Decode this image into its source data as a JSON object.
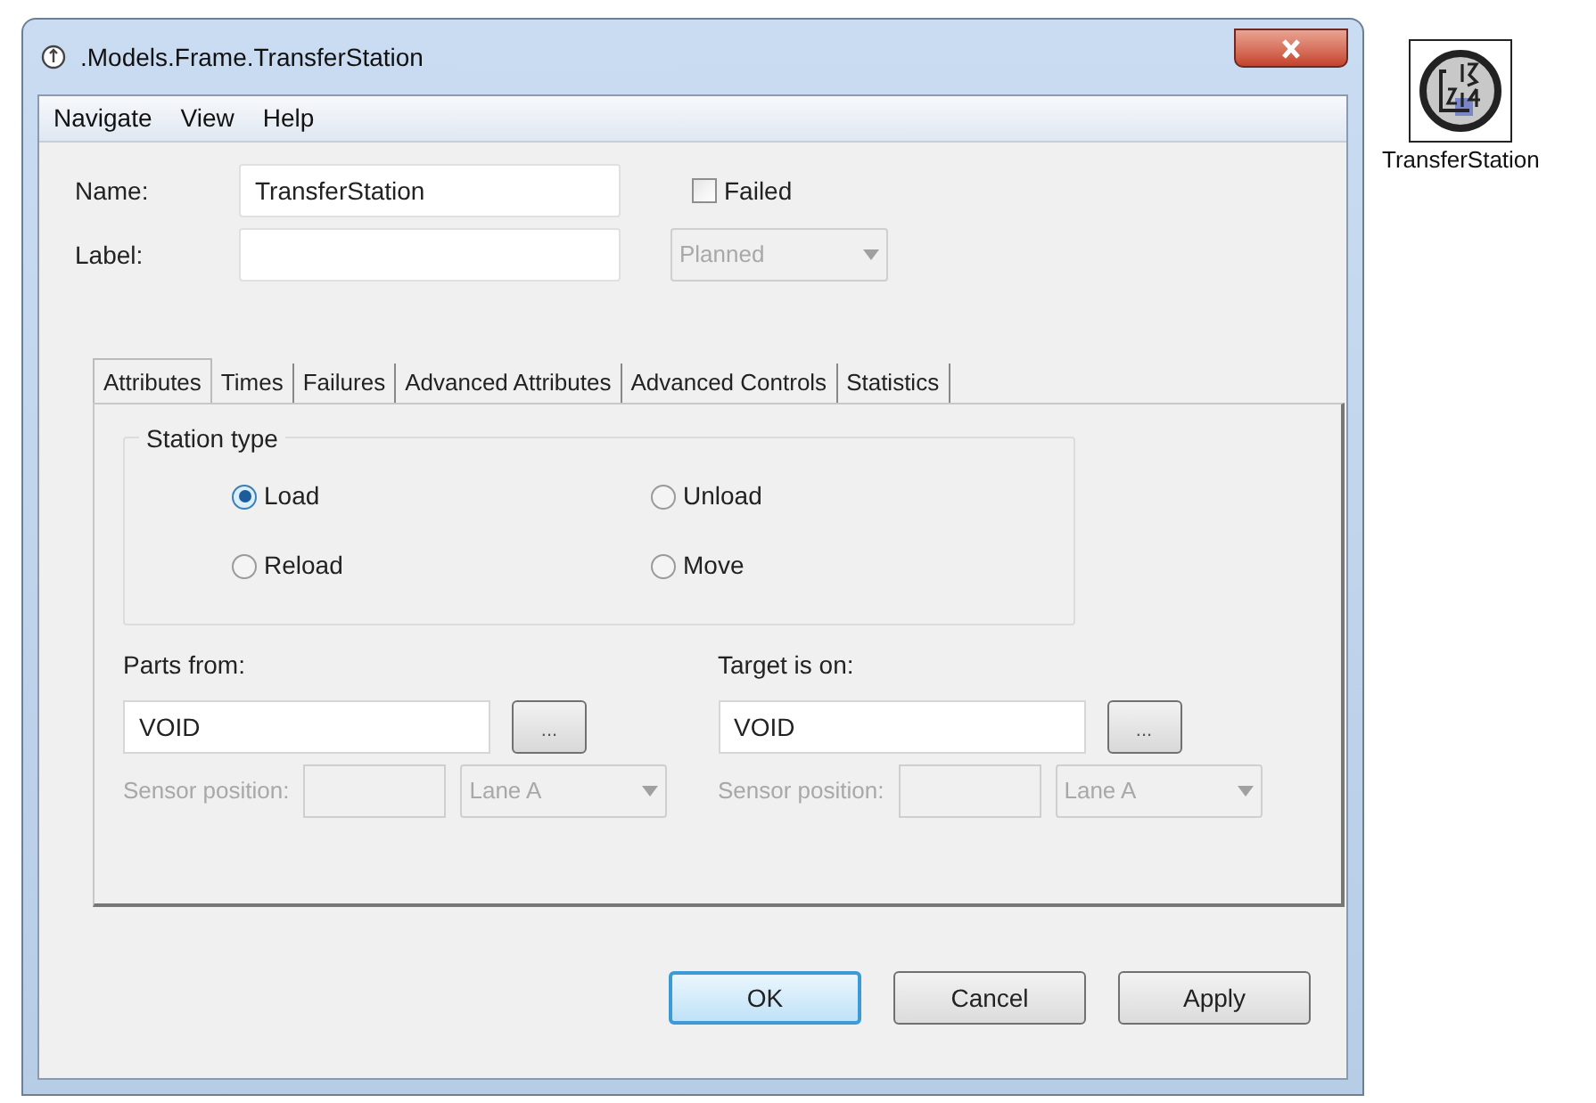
{
  "window": {
    "title": ".Models.Frame.TransferStation"
  },
  "menu": [
    "Navigate",
    "View",
    "Help"
  ],
  "name_field": {
    "label": "Name:",
    "value": "TransferStation"
  },
  "label_field": {
    "label": "Label:"
  },
  "failed": {
    "label": "Failed",
    "checked": false
  },
  "state_dropdown": {
    "value": "Planned",
    "disabled": true
  },
  "tabs": [
    {
      "label": "Attributes",
      "selected": true
    },
    {
      "label": "Times",
      "selected": false
    },
    {
      "label": "Failures",
      "selected": false
    },
    {
      "label": "Advanced Attributes",
      "selected": false
    },
    {
      "label": "Advanced Controls",
      "selected": false
    },
    {
      "label": "Statistics",
      "selected": false
    }
  ],
  "station_type": {
    "title": "Station type",
    "options": [
      {
        "label": "Load",
        "selected": true
      },
      {
        "label": "Unload",
        "selected": false
      },
      {
        "label": "Reload",
        "selected": false
      },
      {
        "label": "Move",
        "selected": false
      }
    ]
  },
  "ports": [
    {
      "label": "Parts from:",
      "value": "VOID",
      "browse": "...",
      "sensor_label": "Sensor position:",
      "lane": "Lane A",
      "disabled": true
    },
    {
      "label": "Target is on:",
      "value": "VOID",
      "browse": "...",
      "sensor_label": "Sensor position:",
      "lane": "Lane A",
      "disabled": true
    }
  ],
  "buttons": [
    {
      "label": "OK",
      "default": true
    },
    {
      "label": "Cancel",
      "default": false
    },
    {
      "label": "Apply",
      "default": false
    }
  ],
  "canvas_object": {
    "label": "TransferStation"
  }
}
